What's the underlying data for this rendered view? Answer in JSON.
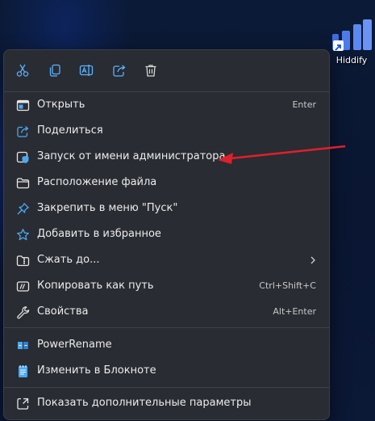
{
  "desktop": {
    "shortcut_label": "Hiddify",
    "icon": "hiddify-icon"
  },
  "toolbar": {
    "buttons": [
      {
        "name": "cut-icon"
      },
      {
        "name": "copy-icon"
      },
      {
        "name": "rename-icon"
      },
      {
        "name": "share-icon"
      },
      {
        "name": "delete-icon"
      }
    ]
  },
  "menu": {
    "items": [
      {
        "label": "Открыть",
        "shortcut": "Enter",
        "icon": "open-icon"
      },
      {
        "label": "Поделиться",
        "shortcut": "",
        "icon": "share-icon"
      },
      {
        "label": "Запуск от имени администратора",
        "shortcut": "",
        "icon": "shield-icon"
      },
      {
        "label": "Расположение файла",
        "shortcut": "",
        "icon": "folder-icon"
      },
      {
        "label": "Закрепить в меню \"Пуск\"",
        "shortcut": "",
        "icon": "pin-icon"
      },
      {
        "label": "Добавить в избранное",
        "shortcut": "",
        "icon": "star-icon"
      },
      {
        "label": "Сжать до...",
        "shortcut": "",
        "icon": "zip-folder-icon",
        "submenu": true
      },
      {
        "label": "Копировать как путь",
        "shortcut": "Ctrl+Shift+C",
        "icon": "copy-path-icon"
      },
      {
        "label": "Свойства",
        "shortcut": "Alt+Enter",
        "icon": "wrench-icon"
      }
    ],
    "extra_items": [
      {
        "label": "PowerRename",
        "icon": "powerrename-icon"
      },
      {
        "label": "Изменить в Блокноте",
        "icon": "notepad-icon"
      }
    ],
    "more_options": {
      "label": "Показать дополнительные параметры",
      "icon": "more-options-icon"
    }
  },
  "colors": {
    "menu_background": "#2a2c33",
    "accent_blue": "#4aa8f0",
    "annotation_arrow": "#e0202a"
  }
}
